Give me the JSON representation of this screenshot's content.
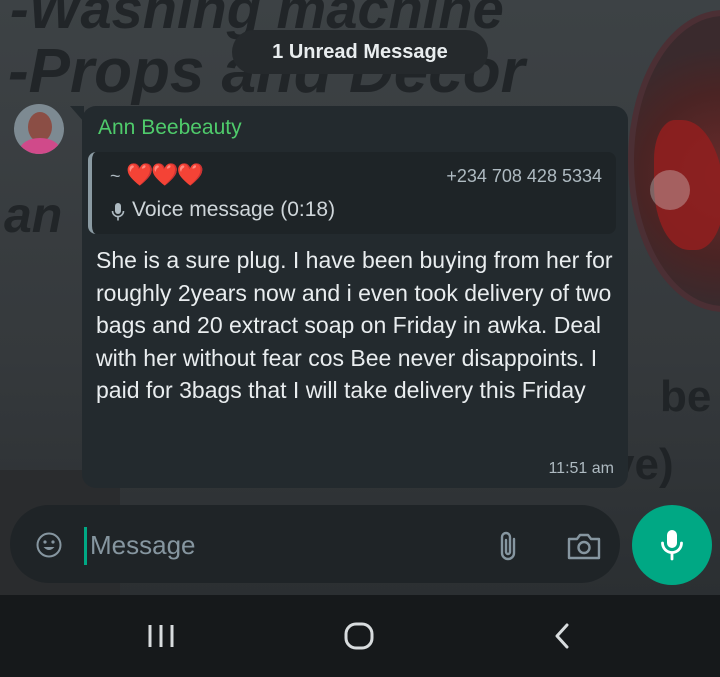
{
  "unread_banner": "1 Unread Message",
  "message": {
    "sender": "Ann Beebeauty",
    "sender_color": "#4fcb6b",
    "quote": {
      "prefix": "~",
      "hearts": "❤️❤️❤️",
      "phone": "+234 708 428 5334",
      "voice_label": "Voice message (0:18)"
    },
    "text": "She is a sure plug. I have been buying from her for roughly 2years now and i even took delivery of two bags and 20 extract soap on Friday in awka. Deal with her without fear cos Bee never disappoints. I paid for 3bags that I will take delivery this Friday",
    "time": "11:51 am"
  },
  "wallpaper": {
    "line1": "-Washing machine",
    "line2": "-Props and Decor",
    "line3": "an",
    "line4": "be",
    "line5": "ve)"
  },
  "composer": {
    "placeholder": "Message",
    "accent_color": "#00a884"
  },
  "icons": {
    "emoji": "emoji-icon",
    "attach": "paperclip-icon",
    "camera": "camera-icon",
    "mic": "mic-icon",
    "voice": "mic-icon",
    "nav_recent": "recent-apps-icon",
    "nav_home": "home-icon",
    "nav_back": "back-icon"
  }
}
